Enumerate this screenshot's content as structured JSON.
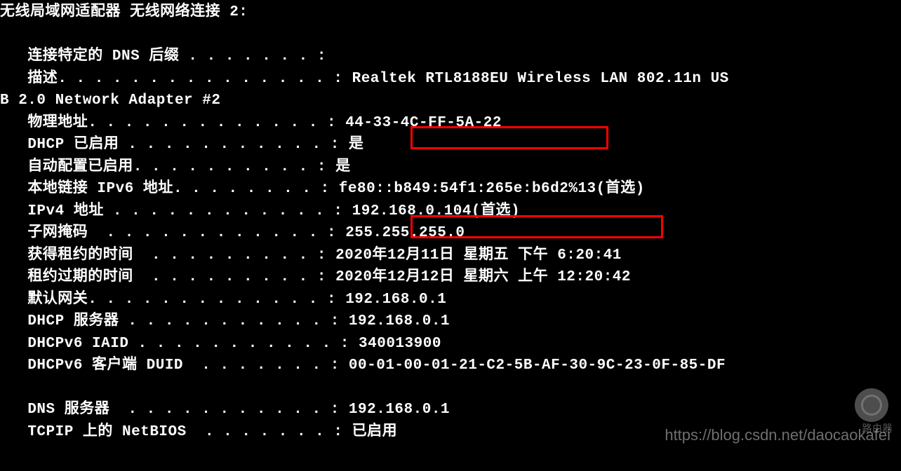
{
  "header": "无线局域网适配器 无线网络连接 2:",
  "line_wrap": "B 2.0 Network Adapter #2",
  "properties": {
    "dns_suffix": {
      "label": "连接特定的 DNS 后缀",
      "dots": " . . . . . . . ",
      "value": ""
    },
    "description": {
      "label": "描述",
      "dots": ". . . . . . . . . . . . . . . ",
      "value": "Realtek RTL8188EU Wireless LAN 802.11n US"
    },
    "physical_address": {
      "label": "物理地址",
      "dots": ". . . . . . . . . . . . . ",
      "value": "44-33-4C-FF-5A-22"
    },
    "dhcp_enabled": {
      "label": "DHCP 已启用",
      "dots": " . . . . . . . . . . . ",
      "value": "是"
    },
    "auto_config": {
      "label": "自动配置已启用",
      "dots": ". . . . . . . . . . ",
      "value": "是"
    },
    "ipv6_local": {
      "label": "本地链接 IPv6 地址",
      "dots": ". . . . . . . . ",
      "value": "fe80::b849:54f1:265e:b6d2%13(首选)"
    },
    "ipv4": {
      "label": "IPv4 地址",
      "dots": " . . . . . . . . . . . . ",
      "value": "192.168.0.104(首选)"
    },
    "subnet_mask": {
      "label": "子网掩码",
      "dots": "  . . . . . . . . . . . . ",
      "value": "255.255.255.0"
    },
    "lease_obtained": {
      "label": "获得租约的时间",
      "dots": "  . . . . . . . . . ",
      "value": "2020年12月11日 星期五 下午 6:20:41"
    },
    "lease_expires": {
      "label": "租约过期的时间",
      "dots": "  . . . . . . . . . ",
      "value": "2020年12月12日 星期六 上午 12:20:42"
    },
    "default_gateway": {
      "label": "默认网关",
      "dots": ". . . . . . . . . . . . . ",
      "value": "192.168.0.1"
    },
    "dhcp_server": {
      "label": "DHCP 服务器",
      "dots": " . . . . . . . . . . . ",
      "value": "192.168.0.1"
    },
    "dhcpv6_iaid": {
      "label": "DHCPv6 IAID",
      "dots": " . . . . . . . . . . . ",
      "value": "340013900"
    },
    "dhcpv6_duid": {
      "label": "DHCPv6 客户端 DUID",
      "dots": "  . . . . . . . ",
      "value": "00-01-00-01-21-C2-5B-AF-30-9C-23-0F-85-DF"
    },
    "dns_servers": {
      "label": "DNS 服务器",
      "dots": "  . . . . . . . . . . . ",
      "value": "192.168.0.1"
    },
    "netbios": {
      "label": "TCPIP 上的 NetBIOS",
      "dots": "  . . . . . . . ",
      "value": "已启用"
    }
  },
  "watermark": {
    "url": "https://blog.csdn.net/daocaokafei",
    "label": "路由器"
  }
}
